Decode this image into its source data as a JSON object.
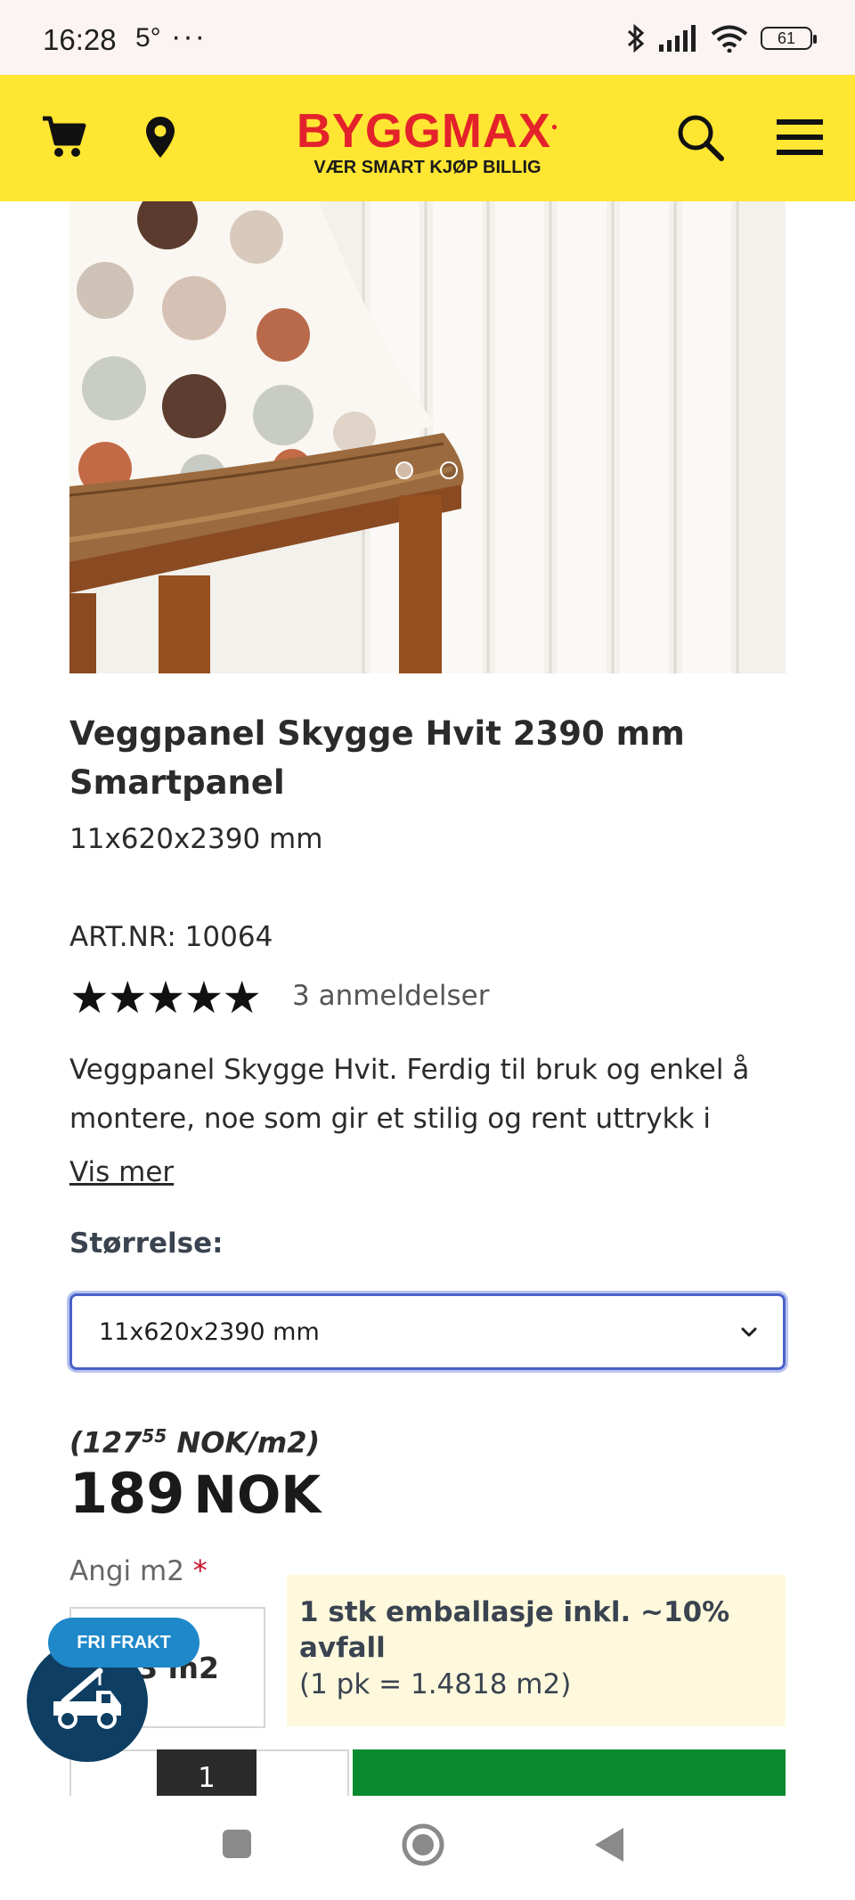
{
  "status_bar": {
    "time": "16:28",
    "temp": "5°",
    "more": "···",
    "battery": "61"
  },
  "header": {
    "brand": "BYGGMAX",
    "tagline": "VÆR SMART KJØP BILLIG"
  },
  "product": {
    "title": "Veggpanel Skygge Hvit 2390 mm Smartpanel",
    "dimensions": "11x620x2390 mm",
    "art_nr": "ART.NR: 10064",
    "rating_stars": "★★★★★",
    "rating": 5,
    "reviews": "3 anmeldelser",
    "description": "Veggpanel Skygge Hvit. Ferdig til bruk og enkel å montere, noe som gir et stilig og rent uttrykk i",
    "show_more": "Vis mer"
  },
  "size": {
    "label": "Størrelse:",
    "selected": "11x620x2390 mm"
  },
  "price": {
    "unit_open": "(127",
    "unit_cents": "55",
    "unit_close": " NOK/m2)",
    "amount": "189",
    "currency": "NOK"
  },
  "quantity": {
    "label": "Angi m2",
    "required_mark": "*",
    "m2_value": "3 m2",
    "info_line1": "1 stk emballasje inkl. ~10% avfall",
    "info_line2": "(1 pk = 1.4818 m2)",
    "count": "1"
  },
  "shipping_badge": {
    "label": "FRI FRAKT"
  },
  "gallery": {
    "slides": 2,
    "active_slide": 1
  },
  "colors": {
    "header_bg": "#ffe632",
    "brand_red": "#e4222b",
    "focus_blue": "#4a61c9",
    "add_green": "#0a8a2f",
    "badge_blue": "#1e88c9"
  }
}
